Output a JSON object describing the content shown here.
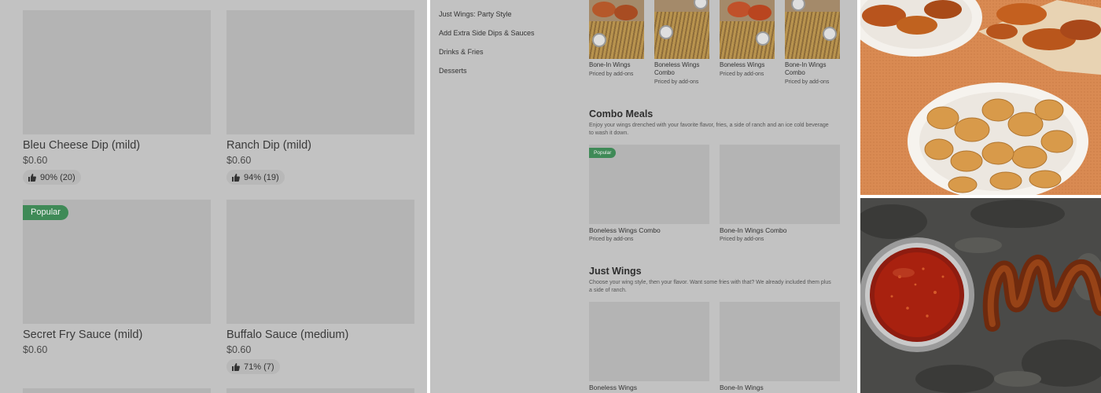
{
  "panel1": {
    "cards": [
      {
        "name": "Bleu Cheese Dip (mild)",
        "price": "$0.60",
        "rating": "90% (20)",
        "badge": ""
      },
      {
        "name": "Ranch Dip (mild)",
        "price": "$0.60",
        "rating": "94% (19)",
        "badge": ""
      },
      {
        "name": "Secret Fry Sauce (mild)",
        "price": "$0.60",
        "rating": "",
        "badge": "Popular"
      },
      {
        "name": "Buffalo Sauce (medium)",
        "price": "$0.60",
        "rating": "71% (7)",
        "badge": ""
      }
    ]
  },
  "panel2": {
    "nav": [
      "Just Wings: Party Style",
      "Add Extra Side Dips & Sauces",
      "Drinks & Fries",
      "Desserts"
    ],
    "party_items": [
      {
        "name": "Bone-In Wings",
        "sub": "Priced by add-ons"
      },
      {
        "name": "Boneless Wings Combo",
        "sub": "Priced by add-ons"
      },
      {
        "name": "Boneless Wings",
        "sub": "Priced by add-ons"
      },
      {
        "name": "Bone-In Wings Combo",
        "sub": "Priced by add-ons"
      }
    ],
    "combo": {
      "title": "Combo Meals",
      "description": "Enjoy your wings drenched with your favorite flavor, fries, a side of ranch and an ice cold beverage to wash it down.",
      "badge": "Popular",
      "items": [
        {
          "name": "Boneless Wings Combo",
          "sub": "Priced by add-ons"
        },
        {
          "name": "Bone-In Wings Combo",
          "sub": "Priced by add-ons"
        }
      ]
    },
    "just_wings": {
      "title": "Just Wings",
      "description": "Choose your wing style, then your flavor. Want some fries with that? We already included them plus a side of ranch.",
      "items": [
        {
          "name": "Boneless Wings"
        },
        {
          "name": "Bone-In Wings"
        }
      ]
    }
  },
  "colors": {
    "overlay_gray": "#c2c2c2",
    "placeholder_gray": "#b4b4b4",
    "popular_green": "#3f8a57",
    "orange_background": "#d98a52",
    "slate_background": "#4a4a48"
  }
}
